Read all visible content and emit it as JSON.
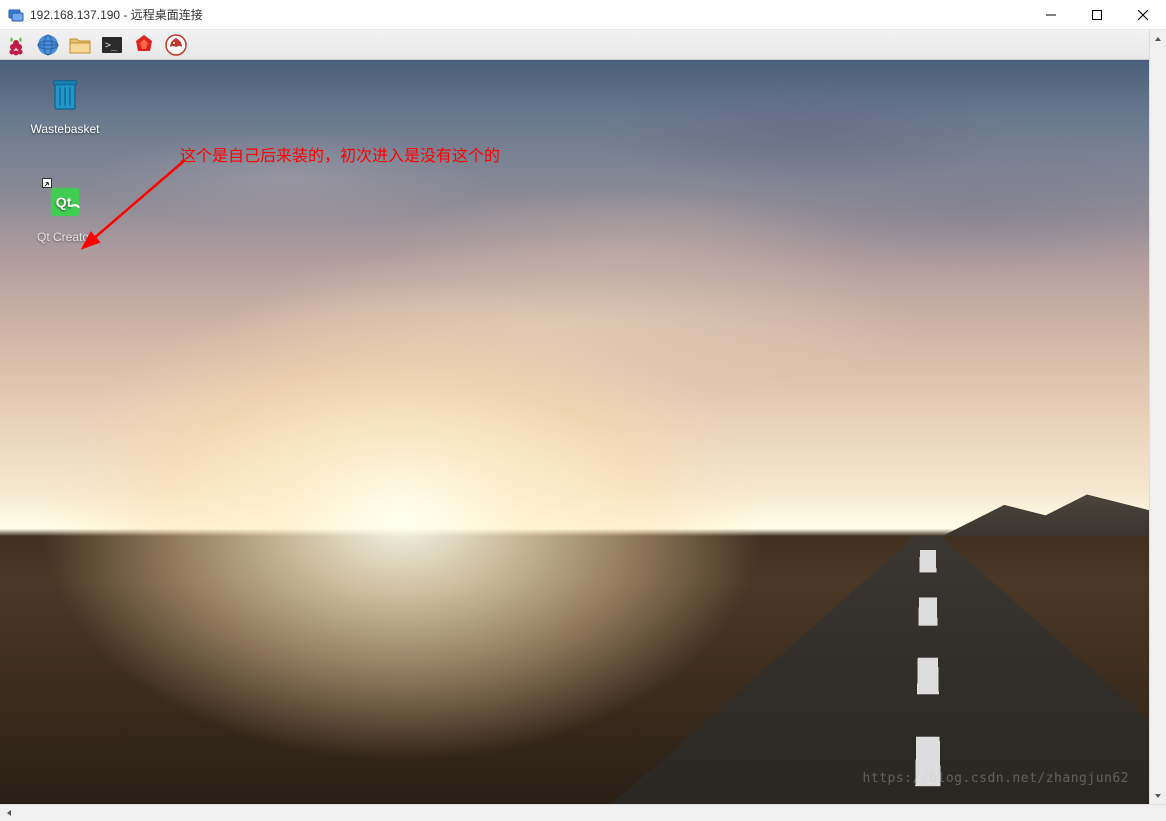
{
  "titlebar": {
    "ip": "192.168.137.190",
    "separator": " - ",
    "app_name": "远程桌面连接"
  },
  "panel": {
    "icons": [
      {
        "name": "raspberry-menu-icon"
      },
      {
        "name": "web-browser-icon"
      },
      {
        "name": "file-manager-icon"
      },
      {
        "name": "terminal-icon"
      },
      {
        "name": "mathematica-icon"
      },
      {
        "name": "midori-icon"
      }
    ]
  },
  "desktop_icons": {
    "wastebasket": {
      "label": "Wastebasket"
    },
    "qtcreator": {
      "label": "Qt Creator",
      "badge": "Qt"
    }
  },
  "annotation": {
    "text": "这个是自己后来装的，初次进入是没有这个的"
  },
  "watermark": "https://blog.csdn.net/zhangjun62"
}
